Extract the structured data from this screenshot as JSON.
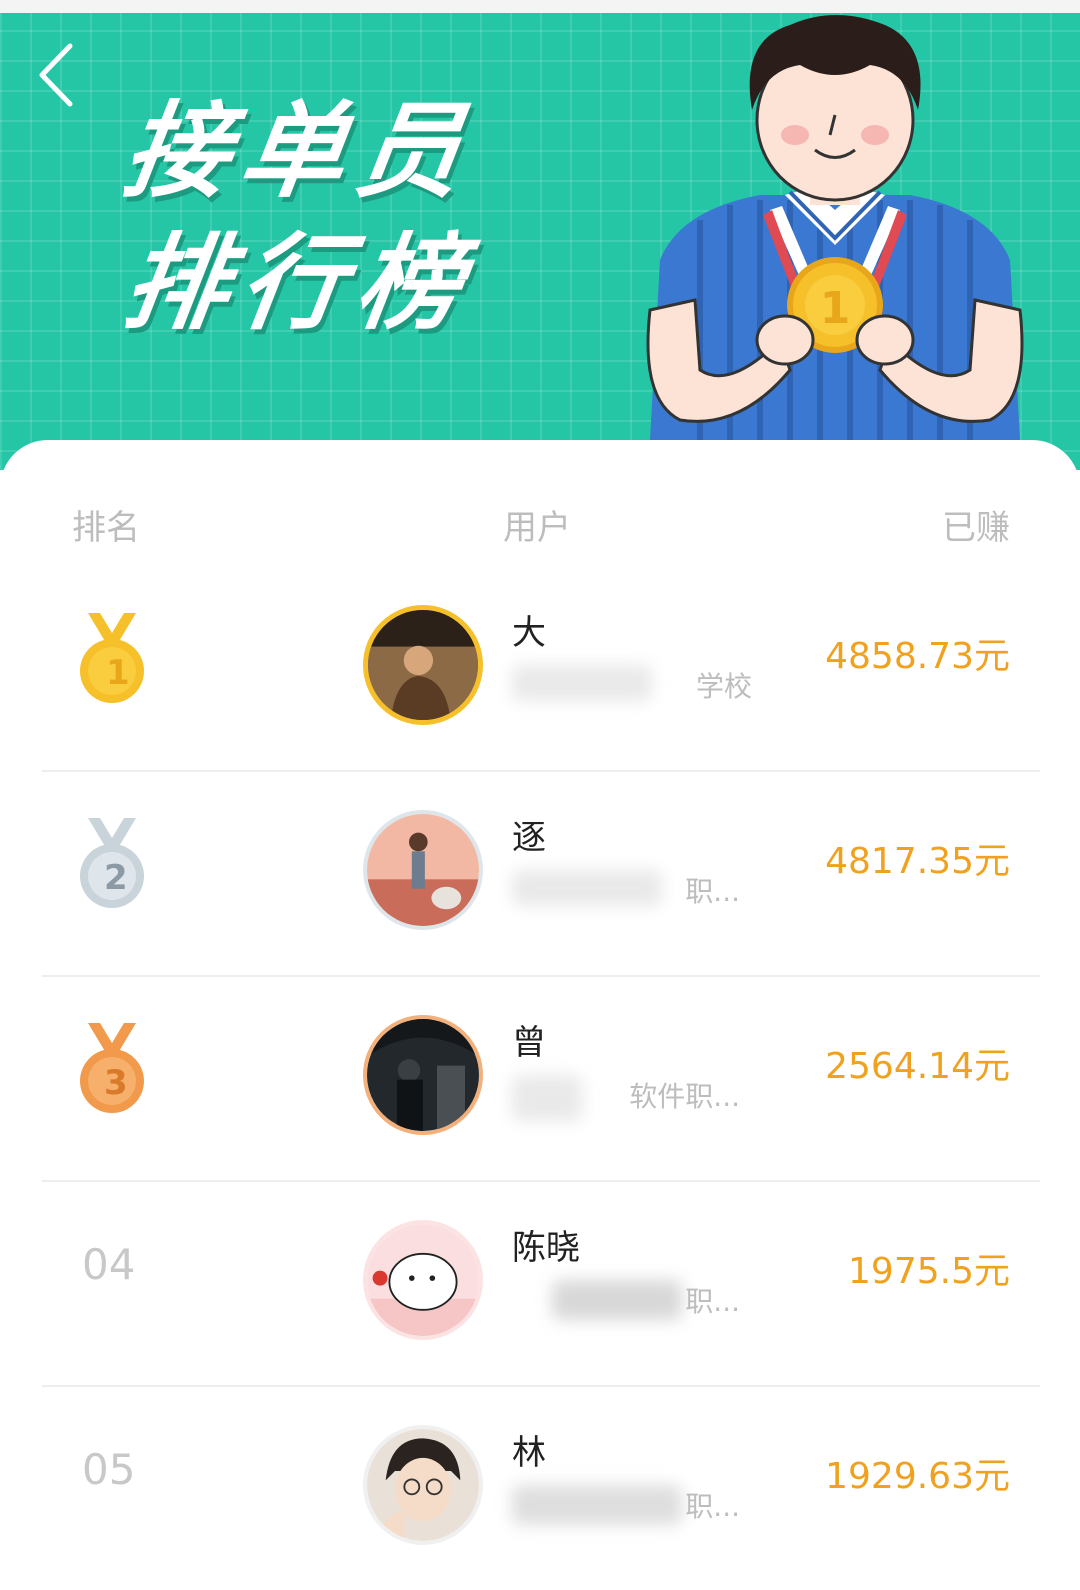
{
  "header": {
    "title_line1": "接单员",
    "title_line2": "排行榜",
    "back_icon": "chevron-left-icon"
  },
  "columns": {
    "rank": "排名",
    "user": "用户",
    "earned": "已赚"
  },
  "rows": [
    {
      "rank": "1",
      "name": "大",
      "school": "学校",
      "earned": "4858.73元",
      "medal_color": "#f6c02a"
    },
    {
      "rank": "2",
      "name": "逐",
      "school": "职...",
      "earned": "4817.35元",
      "medal_color": "#c9d3da"
    },
    {
      "rank": "3",
      "name": "曾",
      "school": "软件职...",
      "earned": "2564.14元",
      "medal_color": "#f19a4c"
    },
    {
      "rank": "04",
      "name": "陈晓",
      "school": "职...",
      "earned": "1975.5元"
    },
    {
      "rank": "05",
      "name": "林",
      "school": "职...",
      "earned": "1929.63元"
    }
  ],
  "colors": {
    "banner": "#25c6a6",
    "earned": "#f0a21e",
    "muted": "#bdbdbd"
  }
}
